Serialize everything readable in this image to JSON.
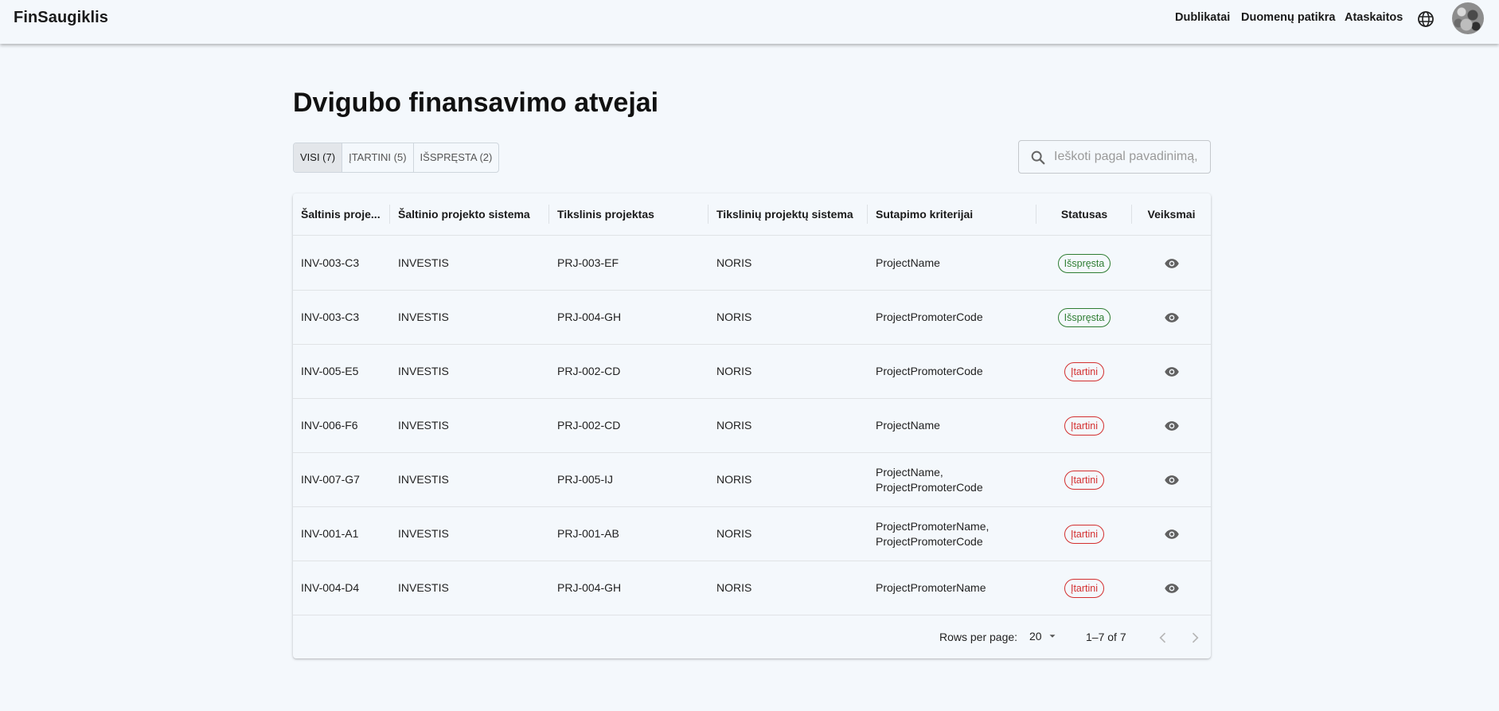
{
  "header": {
    "brand": "FinSaugiklis",
    "nav": [
      "Dublikatai",
      "Duomenų patikra",
      "Ataskaitos"
    ]
  },
  "page": {
    "title": "Dvigubo finansavimo atvejai"
  },
  "filters": {
    "tabs": [
      {
        "label": "VISI (7)",
        "active": true
      },
      {
        "label": "ĮTARTINI (5)",
        "active": false
      },
      {
        "label": "IŠSPRĘSTA (2)",
        "active": false
      }
    ]
  },
  "search": {
    "placeholder": "Ieškoti pagal pavadinimą,"
  },
  "table": {
    "columns": [
      "Šaltinis proje...",
      "Šaltinio projekto sistema",
      "Tikslinis projektas",
      "Tikslinių projektų sistema",
      "Sutapimo kriterijai",
      "Statusas",
      "Veiksmai"
    ],
    "rows": [
      {
        "source": "INV-003-C3",
        "source_system": "INVESTIS",
        "target": "PRJ-003-EF",
        "target_system": "NORIS",
        "criteria": "ProjectName",
        "status": "Išspręsta",
        "status_kind": "resolved"
      },
      {
        "source": "INV-003-C3",
        "source_system": "INVESTIS",
        "target": "PRJ-004-GH",
        "target_system": "NORIS",
        "criteria": "ProjectPromoterCode",
        "status": "Išspręsta",
        "status_kind": "resolved"
      },
      {
        "source": "INV-005-E5",
        "source_system": "INVESTIS",
        "target": "PRJ-002-CD",
        "target_system": "NORIS",
        "criteria": "ProjectPromoterCode",
        "status": "Įtartini",
        "status_kind": "suspicious"
      },
      {
        "source": "INV-006-F6",
        "source_system": "INVESTIS",
        "target": "PRJ-002-CD",
        "target_system": "NORIS",
        "criteria": "ProjectName",
        "status": "Įtartini",
        "status_kind": "suspicious"
      },
      {
        "source": "INV-007-G7",
        "source_system": "INVESTIS",
        "target": "PRJ-005-IJ",
        "target_system": "NORIS",
        "criteria": "ProjectName,\nProjectPromoterCode",
        "status": "Įtartini",
        "status_kind": "suspicious"
      },
      {
        "source": "INV-001-A1",
        "source_system": "INVESTIS",
        "target": "PRJ-001-AB",
        "target_system": "NORIS",
        "criteria": "ProjectPromoterName,\nProjectPromoterCode",
        "status": "Įtartini",
        "status_kind": "suspicious"
      },
      {
        "source": "INV-004-D4",
        "source_system": "INVESTIS",
        "target": "PRJ-004-GH",
        "target_system": "NORIS",
        "criteria": "ProjectPromoterName",
        "status": "Įtartini",
        "status_kind": "suspicious"
      }
    ]
  },
  "pagination": {
    "rows_per_page_label": "Rows per page:",
    "rows_per_page": "20",
    "range": "1–7 of 7"
  },
  "colors": {
    "background": "#f4f8fc",
    "resolved": "#2e7d32",
    "suspicious": "#d32f2f"
  },
  "icons": {
    "language": "globe-icon",
    "search": "search-icon",
    "view": "eye-icon",
    "dropdown": "caret-down-icon",
    "prev": "chevron-left-icon",
    "next": "chevron-right-icon"
  }
}
